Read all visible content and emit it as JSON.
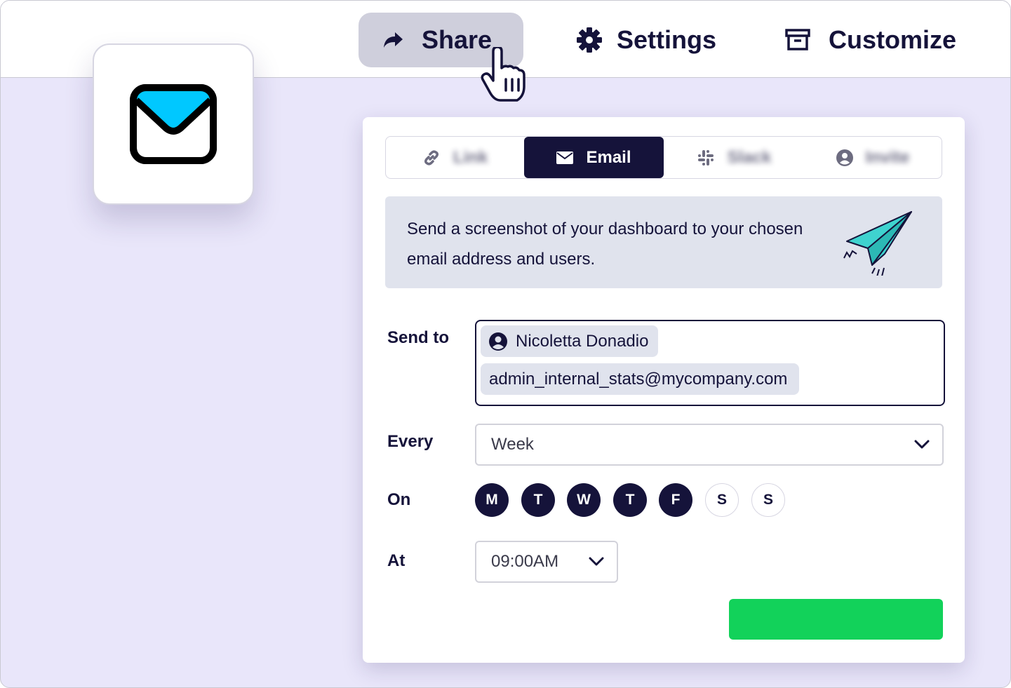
{
  "toolbar": {
    "share_label": "Share",
    "settings_label": "Settings",
    "customize_label": "Customize"
  },
  "share_panel": {
    "tabs": [
      {
        "label": "Link",
        "icon": "link-icon",
        "active": false
      },
      {
        "label": "Email",
        "icon": "envelope-icon",
        "active": true
      },
      {
        "label": "Slack",
        "icon": "slack-icon",
        "active": false
      },
      {
        "label": "Invite",
        "icon": "user-circle-icon",
        "active": false
      }
    ],
    "banner_text": "Send a screenshot of your dashboard to your chosen email address and users.",
    "form": {
      "send_to_label": "Send to",
      "recipients": [
        "Nicoletta Donadio",
        "admin_internal_stats@mycompany.com"
      ],
      "every_label": "Every",
      "every_value": "Week",
      "on_label": "On",
      "days": [
        {
          "label": "M",
          "selected": true
        },
        {
          "label": "T",
          "selected": true
        },
        {
          "label": "W",
          "selected": true
        },
        {
          "label": "T",
          "selected": true
        },
        {
          "label": "F",
          "selected": true
        },
        {
          "label": "S",
          "selected": false
        },
        {
          "label": "S",
          "selected": false
        }
      ],
      "at_label": "At",
      "at_value": "09:00AM"
    }
  },
  "colors": {
    "primary": "#15133a",
    "background": "#e9e6fa",
    "submit": "#12d25a",
    "mail_accent": "#00c8ff",
    "plane": "#3fd3cf"
  }
}
